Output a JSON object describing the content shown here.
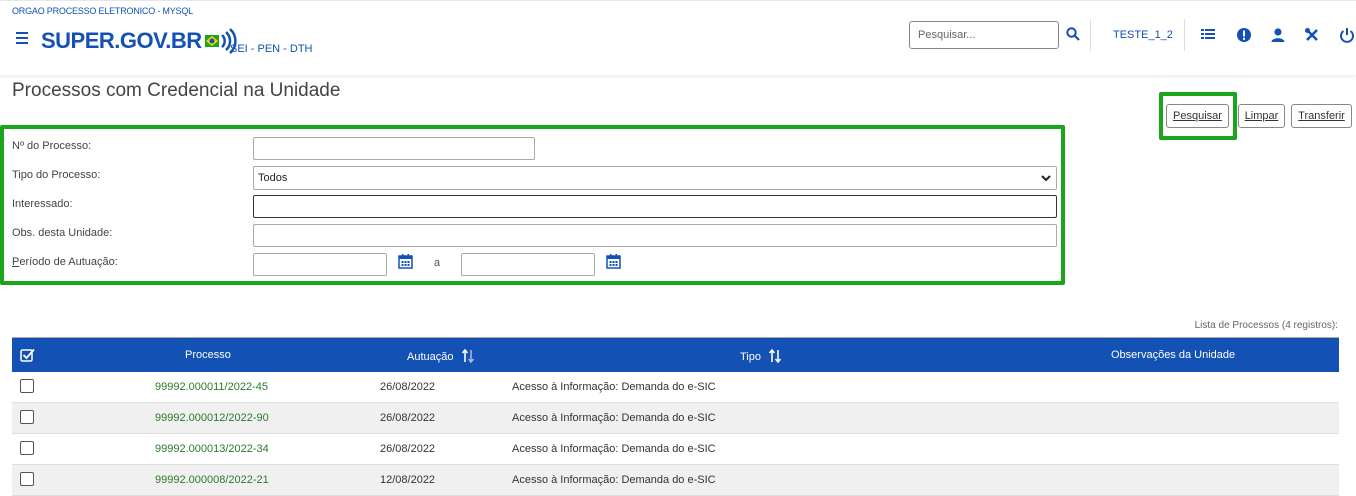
{
  "header": {
    "org": "ORGAO PROCESSO ELETRONICO - MYSQL",
    "logo": "SUPER.GOV.BR",
    "system": "SEI - PEN - DTH",
    "search_placeholder": "Pesquisar...",
    "unit": "TESTE_1_2",
    "icons": [
      "menu-icon",
      "search-icon",
      "control-panel-icon",
      "alert-icon",
      "user-icon",
      "tools-icon",
      "power-icon"
    ]
  },
  "page": {
    "title": "Processos com Credencial na Unidade"
  },
  "buttons": {
    "pesquisar": "Pesquisar",
    "limpar": "Limpar",
    "transferir": "Transferir"
  },
  "form": {
    "numero_label": "Nº do Processo:",
    "tipo_label": "Tipo do Processo:",
    "tipo_value": "Todos",
    "interessado_label": "Interessado:",
    "obs_label": "Obs. desta Unidade:",
    "periodo_label_first": "P",
    "periodo_label_rest": "eríodo de Autuação:",
    "periodo_separator": "a"
  },
  "table": {
    "caption": "Lista de Processos (4 registros):",
    "columns": {
      "processo": "Processo",
      "autuacao": "Autuação",
      "tipo": "Tipo",
      "observacoes": "Observações da Unidade"
    },
    "rows": [
      {
        "processo": "99992.000011/2022-45",
        "autuacao": "26/08/2022",
        "tipo": "Acesso à Informação: Demanda do e-SIC",
        "observacoes": ""
      },
      {
        "processo": "99992.000012/2022-90",
        "autuacao": "26/08/2022",
        "tipo": "Acesso à Informação: Demanda do e-SIC",
        "observacoes": ""
      },
      {
        "processo": "99992.000013/2022-34",
        "autuacao": "26/08/2022",
        "tipo": "Acesso à Informação: Demanda do e-SIC",
        "observacoes": ""
      },
      {
        "processo": "99992.000008/2022-21",
        "autuacao": "12/08/2022",
        "tipo": "Acesso à Informação: Demanda do e-SIC",
        "observacoes": ""
      }
    ]
  },
  "colors": {
    "brand_blue": "#1351b4",
    "highlight_green": "#1aa51a",
    "link_green": "#2b7a2b"
  }
}
